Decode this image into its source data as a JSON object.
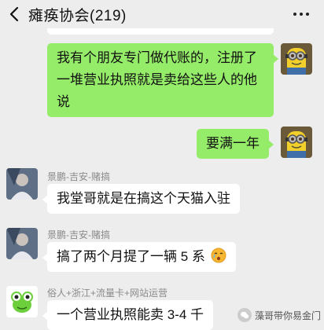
{
  "header": {
    "title": "瘫痪协会(219)"
  },
  "messages": [
    {
      "text": "我有个朋友专门做代账的，注册了一堆营业执照就是卖给这些人的他说"
    },
    {
      "text": "要满一年"
    },
    {
      "sender": "景鹏-吉安-赌搞",
      "text": "我堂哥就是在搞这个天猫入驻"
    },
    {
      "sender": "景鹏-吉安-赌搞",
      "text": "搞了两个月提了一辆 5 系"
    },
    {
      "sender": "俗人+浙江+流量卡+网站运营",
      "text": "一个营业执照能卖 3-4 千"
    }
  ],
  "watermark": "藻哥带你易金门"
}
